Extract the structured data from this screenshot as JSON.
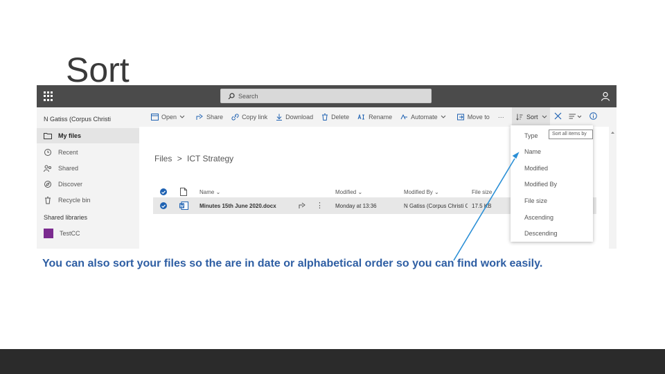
{
  "slide": {
    "title": "Sort",
    "caption": "You can also sort your files so the are in date or alphabetical order so you can find work easily."
  },
  "topbar": {
    "search_placeholder": "Search"
  },
  "sidebar": {
    "tenant": "N Gatiss (Corpus Christi",
    "items": [
      {
        "label": "My files",
        "icon": "folder-icon"
      },
      {
        "label": "Recent",
        "icon": "clock-icon"
      },
      {
        "label": "Shared",
        "icon": "shared-icon"
      },
      {
        "label": "Discover",
        "icon": "discover-icon"
      },
      {
        "label": "Recycle bin",
        "icon": "recycle-bin-icon"
      }
    ],
    "libraries_header": "Shared libraries",
    "library": "TestCC"
  },
  "commandbar": {
    "open": "Open",
    "share": "Share",
    "copy_link": "Copy link",
    "download": "Download",
    "delete": "Delete",
    "rename": "Rename",
    "automate": "Automate",
    "move_to": "Move to",
    "more": "···",
    "sort": "Sort"
  },
  "breadcrumb": {
    "root": "Files",
    "separator": ">",
    "current": "ICT Strategy"
  },
  "list": {
    "headers": {
      "name": "Name",
      "modified": "Modified",
      "modified_by": "Modified By",
      "file_size": "File size"
    },
    "rows": [
      {
        "name": "Minutes 15th June 2020.docx",
        "modified": "Monday at 13:36",
        "modified_by": "N Gatiss (Corpus Christi Ca",
        "file_size": "17.5 KB"
      }
    ]
  },
  "sort_menu": {
    "type_label": "Type",
    "type_value": "Sort all items by",
    "options": [
      "Name",
      "Modified",
      "Modified By",
      "File size",
      "Ascending",
      "Descending"
    ]
  },
  "colors": {
    "topbar": "#4b4b4b",
    "accent": "#1f62b2",
    "caption": "#2e5ea3",
    "arrow": "#2a8fd6",
    "footer": "#2b2b2b"
  }
}
